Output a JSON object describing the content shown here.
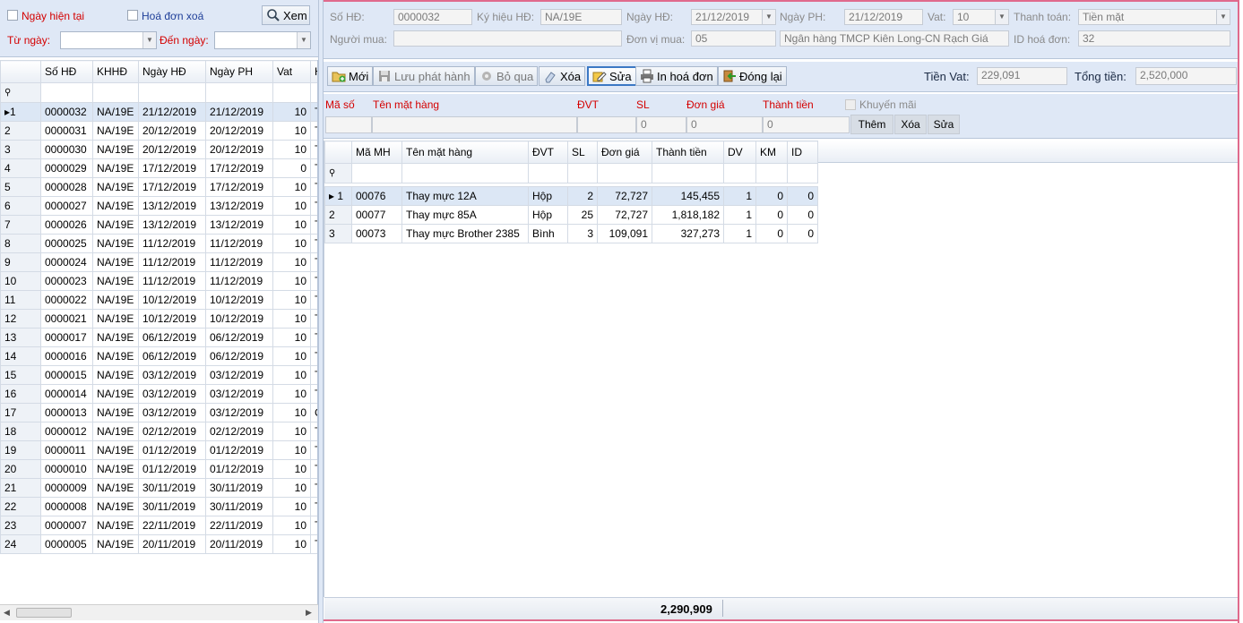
{
  "filter": {
    "today_label": "Ngày hiện tại",
    "deleted_label": "Hoá đơn xoá",
    "view_label": "Xem",
    "from_label": "Từ ngày:",
    "to_label": "Đến ngày:",
    "from_value": "",
    "to_value": ""
  },
  "invoice_list": {
    "columns": [
      "Số HĐ",
      "KHHĐ",
      "Ngày HĐ",
      "Ngày PH",
      "Vat",
      "H"
    ],
    "rows": [
      {
        "idx": "1",
        "so": "0000032",
        "kh": "NA/19E",
        "hd": "21/12/2019",
        "ph": "21/12/2019",
        "vat": "10",
        "t": "T"
      },
      {
        "idx": "2",
        "so": "0000031",
        "kh": "NA/19E",
        "hd": "20/12/2019",
        "ph": "20/12/2019",
        "vat": "10",
        "t": "T"
      },
      {
        "idx": "3",
        "so": "0000030",
        "kh": "NA/19E",
        "hd": "20/12/2019",
        "ph": "20/12/2019",
        "vat": "10",
        "t": "T"
      },
      {
        "idx": "4",
        "so": "0000029",
        "kh": "NA/19E",
        "hd": "17/12/2019",
        "ph": "17/12/2019",
        "vat": "0",
        "t": "T"
      },
      {
        "idx": "5",
        "so": "0000028",
        "kh": "NA/19E",
        "hd": "17/12/2019",
        "ph": "17/12/2019",
        "vat": "10",
        "t": "T"
      },
      {
        "idx": "6",
        "so": "0000027",
        "kh": "NA/19E",
        "hd": "13/12/2019",
        "ph": "13/12/2019",
        "vat": "10",
        "t": "T"
      },
      {
        "idx": "7",
        "so": "0000026",
        "kh": "NA/19E",
        "hd": "13/12/2019",
        "ph": "13/12/2019",
        "vat": "10",
        "t": "T"
      },
      {
        "idx": "8",
        "so": "0000025",
        "kh": "NA/19E",
        "hd": "11/12/2019",
        "ph": "11/12/2019",
        "vat": "10",
        "t": "T"
      },
      {
        "idx": "9",
        "so": "0000024",
        "kh": "NA/19E",
        "hd": "11/12/2019",
        "ph": "11/12/2019",
        "vat": "10",
        "t": "T"
      },
      {
        "idx": "10",
        "so": "0000023",
        "kh": "NA/19E",
        "hd": "11/12/2019",
        "ph": "11/12/2019",
        "vat": "10",
        "t": "T"
      },
      {
        "idx": "11",
        "so": "0000022",
        "kh": "NA/19E",
        "hd": "10/12/2019",
        "ph": "10/12/2019",
        "vat": "10",
        "t": "T"
      },
      {
        "idx": "12",
        "so": "0000021",
        "kh": "NA/19E",
        "hd": "10/12/2019",
        "ph": "10/12/2019",
        "vat": "10",
        "t": "T"
      },
      {
        "idx": "13",
        "so": "0000017",
        "kh": "NA/19E",
        "hd": "06/12/2019",
        "ph": "06/12/2019",
        "vat": "10",
        "t": "T"
      },
      {
        "idx": "14",
        "so": "0000016",
        "kh": "NA/19E",
        "hd": "06/12/2019",
        "ph": "06/12/2019",
        "vat": "10",
        "t": "T"
      },
      {
        "idx": "15",
        "so": "0000015",
        "kh": "NA/19E",
        "hd": "03/12/2019",
        "ph": "03/12/2019",
        "vat": "10",
        "t": "T"
      },
      {
        "idx": "16",
        "so": "0000014",
        "kh": "NA/19E",
        "hd": "03/12/2019",
        "ph": "03/12/2019",
        "vat": "10",
        "t": "T"
      },
      {
        "idx": "17",
        "so": "0000013",
        "kh": "NA/19E",
        "hd": "03/12/2019",
        "ph": "03/12/2019",
        "vat": "10",
        "t": "C"
      },
      {
        "idx": "18",
        "so": "0000012",
        "kh": "NA/19E",
        "hd": "02/12/2019",
        "ph": "02/12/2019",
        "vat": "10",
        "t": "T"
      },
      {
        "idx": "19",
        "so": "0000011",
        "kh": "NA/19E",
        "hd": "01/12/2019",
        "ph": "01/12/2019",
        "vat": "10",
        "t": "T"
      },
      {
        "idx": "20",
        "so": "0000010",
        "kh": "NA/19E",
        "hd": "01/12/2019",
        "ph": "01/12/2019",
        "vat": "10",
        "t": "T"
      },
      {
        "idx": "21",
        "so": "0000009",
        "kh": "NA/19E",
        "hd": "30/11/2019",
        "ph": "30/11/2019",
        "vat": "10",
        "t": "T"
      },
      {
        "idx": "22",
        "so": "0000008",
        "kh": "NA/19E",
        "hd": "30/11/2019",
        "ph": "30/11/2019",
        "vat": "10",
        "t": "T"
      },
      {
        "idx": "23",
        "so": "0000007",
        "kh": "NA/19E",
        "hd": "22/11/2019",
        "ph": "22/11/2019",
        "vat": "10",
        "t": "T"
      },
      {
        "idx": "24",
        "so": "0000005",
        "kh": "NA/19E",
        "hd": "20/11/2019",
        "ph": "20/11/2019",
        "vat": "10",
        "t": "T"
      }
    ]
  },
  "header_form": {
    "so_hd_label": "Số HĐ:",
    "so_hd": "0000032",
    "ky_hieu_label": "Ký hiệu HĐ:",
    "ky_hieu": "NA/19E",
    "ngay_hd_label": "Ngày HĐ:",
    "ngay_hd": "21/12/2019",
    "ngay_ph_label": "Ngày PH:",
    "ngay_ph": "21/12/2019",
    "vat_label": "Vat:",
    "vat": "10",
    "thanh_toan_label": "Thanh toán:",
    "thanh_toan": "Tiền mặt",
    "nguoi_mua_label": "Người mua:",
    "nguoi_mua": "",
    "don_vi_label": "Đơn vị mua:",
    "don_vi_code": "05",
    "don_vi_name": "Ngân hàng TMCP Kiên Long-CN Rạch Giá",
    "id_label": "ID hoá đơn:",
    "id": "32"
  },
  "toolbar": {
    "new": "Mới",
    "save": "Lưu phát hành",
    "skip": "Bỏ qua",
    "delete": "Xóa",
    "edit": "Sửa",
    "print": "In hoá đơn",
    "close": "Đóng lại",
    "tien_vat_label": "Tiền Vat:",
    "tien_vat": "229,091",
    "tong_tien_label": "Tổng tiền:",
    "tong_tien": "2,520,000"
  },
  "item_entry": {
    "ma_so": "Mã số",
    "ten": "Tên mặt hàng",
    "dvt": "ĐVT",
    "sl": "SL",
    "don_gia": "Đơn giá",
    "thanh_tien": "Thành tiền",
    "khuyen_mai": "Khuyến mãi",
    "sl_value": "0",
    "don_gia_value": "0",
    "thanh_tien_value": "0",
    "add": "Thêm",
    "delete": "Xóa",
    "edit": "Sửa"
  },
  "items_grid": {
    "columns": [
      "Mã MH",
      "Tên mặt hàng",
      "ĐVT",
      "SL",
      "Đơn giá",
      "Thành tiền",
      "DV",
      "KM",
      "ID"
    ],
    "rows": [
      {
        "idx": "1",
        "ma": "00076",
        "ten": "Thay mực 12A",
        "dvt": "Hộp",
        "sl": "2",
        "gia": "72,727",
        "tt": "145,455",
        "dv": "1",
        "km": "0",
        "id": "0"
      },
      {
        "idx": "2",
        "ma": "00077",
        "ten": "Thay mực 85A",
        "dvt": "Hộp",
        "sl": "25",
        "gia": "72,727",
        "tt": "1,818,182",
        "dv": "1",
        "km": "0",
        "id": "0"
      },
      {
        "idx": "3",
        "ma": "00073",
        "ten": "Thay mực Brother 2385",
        "dvt": "Bình",
        "sl": "3",
        "gia": "109,091",
        "tt": "327,273",
        "dv": "1",
        "km": "0",
        "id": "0"
      }
    ],
    "total": "2,290,909"
  }
}
